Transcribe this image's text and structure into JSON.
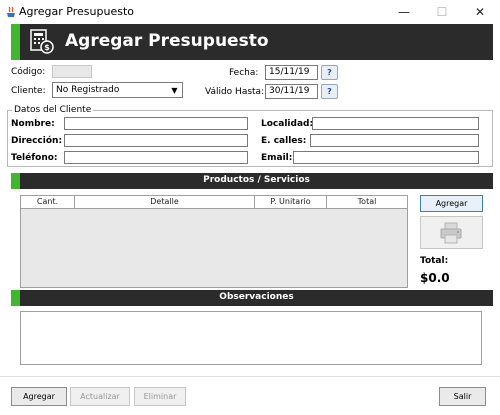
{
  "window": {
    "title": "Agregar Presupuesto",
    "controls": [
      "—",
      "☐",
      "✕"
    ]
  },
  "header": {
    "title": "Agregar Presupuesto",
    "icon": "calculator-invoice-icon"
  },
  "form": {
    "codigo_label": "Código:",
    "codigo_value": "",
    "cliente_label": "Cliente:",
    "cliente_value": "No Registrado",
    "fecha_label": "Fecha:",
    "fecha_value": "15/11/19",
    "valido_label": "Válido Hasta:",
    "valido_value": "30/11/19",
    "cal_glyph": "?"
  },
  "cliente": {
    "group_title": "Datos del Cliente",
    "nombre_label": "Nombre:",
    "direccion_label": "Dirección:",
    "telefono_label": "Teléfono:",
    "localidad_label": "Localidad:",
    "calles_label": "E. calles:",
    "email_label": "Email:"
  },
  "productos": {
    "title": "Productos / Servicios",
    "columns": [
      "Cant.",
      "Detalle",
      "P. Unitario",
      "Total"
    ],
    "agregar_label": "Agregar",
    "total_label": "Total:",
    "total_value": "$0.0"
  },
  "observaciones": {
    "title": "Observaciones"
  },
  "footer": {
    "agregar_label": "Agregar",
    "actualizar_label": "Actualizar",
    "eliminar_label": "Eliminar",
    "salir_label": "Salir"
  },
  "colors": {
    "header_bg": "#2b2b2b",
    "accent": "#41b72f"
  }
}
